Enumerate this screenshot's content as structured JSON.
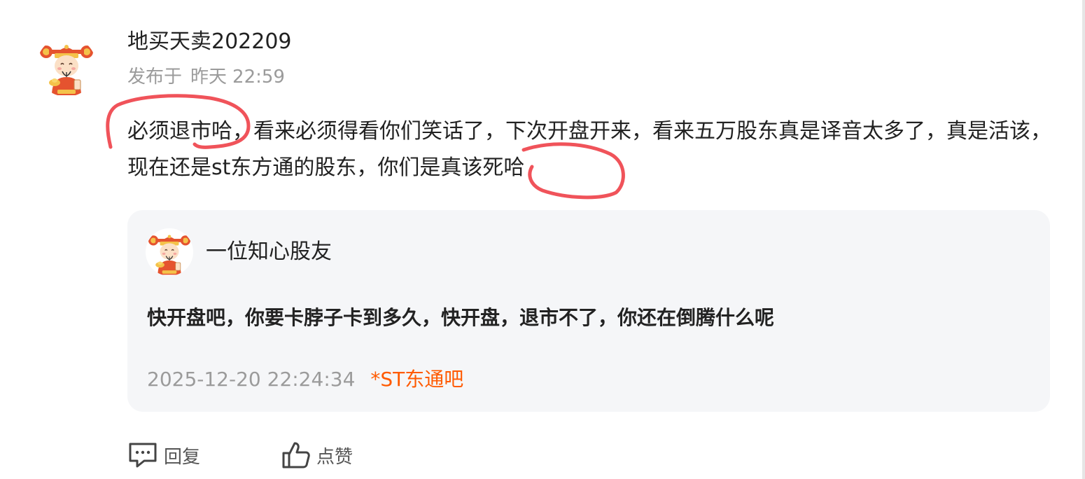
{
  "post": {
    "author": "地买天卖202209",
    "time_prefix": "发布于",
    "time_day": "昨天",
    "time_clock": "22:59",
    "body": "必须退市哈，看来必须得看你们笑话了，下次开盘开来，看来五万股东真是译音太多了，真是活该，现在还是st东方通的股东，你们是真该死哈"
  },
  "quote": {
    "author": "一位知心股友",
    "text": "快开盘吧，你要卡脖子卡到多久，快开盘，退市不了，你还在倒腾什么呢",
    "date": "2025-12-20 22:24:34",
    "forum": "*ST东通吧"
  },
  "actions": {
    "reply_label": "回复",
    "like_label": "点赞",
    "reply_icon": "comment-icon",
    "like_icon": "thumbs-up-icon"
  },
  "colors": {
    "forum_accent": "#ff5a00",
    "annotation_red": "#f0535a",
    "card_background": "#f5f6f8",
    "muted_text": "#9b9b9b"
  }
}
